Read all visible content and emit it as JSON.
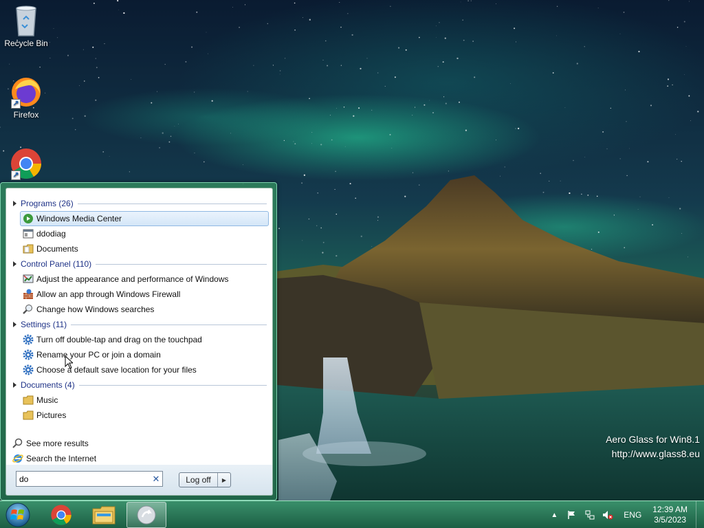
{
  "desktop": {
    "icons": [
      {
        "label": "Recycle Bin",
        "icon": "recycle-bin-icon"
      },
      {
        "label": "Firefox",
        "icon": "firefox-icon"
      },
      {
        "label": "",
        "icon": "chrome-icon"
      }
    ],
    "watermark": {
      "line1": "Aero Glass for Win8.1",
      "line2": "http://www.glass8.eu"
    }
  },
  "start_menu": {
    "groups": [
      {
        "header": "Programs (26)",
        "items": [
          {
            "label": "Windows Media Center",
            "icon": "media-center-icon",
            "selected": true
          },
          {
            "label": "ddodiag",
            "icon": "app-window-icon"
          },
          {
            "label": "Documents",
            "icon": "folder-icon"
          }
        ]
      },
      {
        "header": "Control Panel (110)",
        "items": [
          {
            "label": "Adjust the appearance and performance of Windows",
            "icon": "performance-icon"
          },
          {
            "label": "Allow an app through Windows Firewall",
            "icon": "firewall-icon"
          },
          {
            "label": "Change how Windows searches",
            "icon": "search-options-icon"
          }
        ]
      },
      {
        "header": "Settings (11)",
        "items": [
          {
            "label": "Turn off double-tap and drag on the touchpad",
            "icon": "gear-icon"
          },
          {
            "label": "Rename your PC or join a domain",
            "icon": "gear-icon"
          },
          {
            "label": "Choose a default save location for your files",
            "icon": "gear-icon"
          }
        ]
      },
      {
        "header": "Documents (4)",
        "items": [
          {
            "label": "Music",
            "icon": "folder-icon"
          },
          {
            "label": "Pictures",
            "icon": "folder-icon"
          }
        ]
      }
    ],
    "see_more": "See more results",
    "search_internet": "Search the Internet",
    "search_value": "do",
    "logoff_label": "Log off"
  },
  "taskbar": {
    "apps": [
      "chrome",
      "file-explorer",
      "start-menu-app"
    ],
    "language": "ENG",
    "time": "12:39 AM",
    "date": "3/5/2023"
  }
}
